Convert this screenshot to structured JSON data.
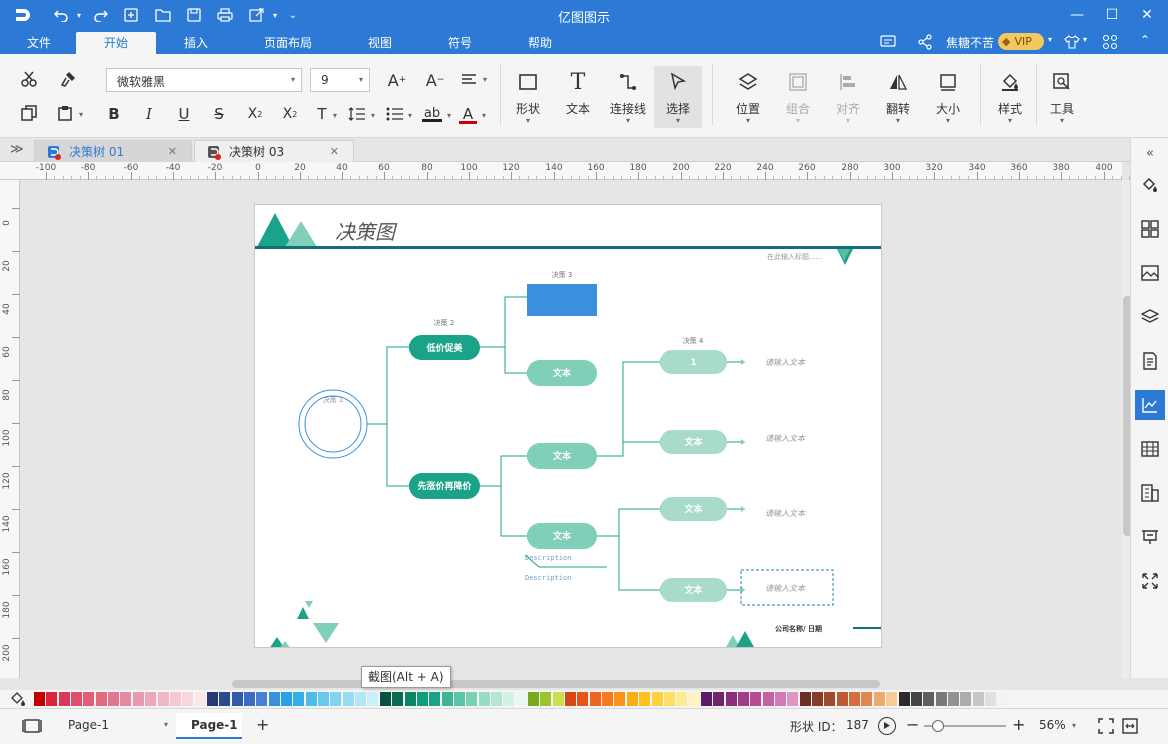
{
  "app": {
    "title": "亿图图示"
  },
  "menubar": {
    "tabs": [
      "文件",
      "开始",
      "插入",
      "页面布局",
      "视图",
      "符号",
      "帮助"
    ],
    "active": "开始",
    "user_name": "焦糖不苦",
    "vip_label": "VIP"
  },
  "ribbon": {
    "font_name": "微软雅黑",
    "font_size": "9",
    "groups": {
      "shape": "形状",
      "text": "文本",
      "connector": "连接线",
      "select": "选择",
      "position": "位置",
      "group": "组合",
      "align": "对齐",
      "flip": "翻转",
      "size": "大小",
      "style": "样式",
      "tools": "工具"
    }
  },
  "doc_tabs": [
    {
      "label": "决策树 01",
      "active": true
    },
    {
      "label": "决策树 03",
      "active": false
    }
  ],
  "ruler": {
    "h_ticks": [
      "-100",
      "-80",
      "-60",
      "-40",
      "-20",
      "0",
      "20",
      "40",
      "60",
      "80",
      "100",
      "120",
      "140",
      "160",
      "180",
      "200",
      "220",
      "240",
      "260",
      "280",
      "300",
      "320",
      "340",
      "360",
      "380",
      "400"
    ],
    "v_ticks": [
      "0",
      "20",
      "40",
      "60",
      "80",
      "100",
      "120",
      "140",
      "160",
      "180",
      "200"
    ]
  },
  "diagram": {
    "title": "决策图",
    "subtitle_hint": "在此输入标题......",
    "root_label": "决策 1",
    "label_decision2": "决策 2",
    "label_decision3": "决策 3",
    "label_decision4": "决策 4",
    "node_low_price": "低价促美",
    "node_first_price": "先涨价再降价",
    "node_text": "文本",
    "node_one": "1",
    "desc1": "Description",
    "desc2": "Description",
    "hint_text": "请输入文本",
    "footer": "公司名称/ 日期"
  },
  "tooltip": "截图(Alt + A)",
  "status": {
    "page_selector": "Page-1",
    "page_tab": "Page-1",
    "add_page": "+",
    "shape_id_label": "形状 ID：",
    "shape_id": "187",
    "zoom_minus": "−",
    "zoom_plus": "+",
    "zoom": "56%",
    "zoom_fraction": 0.12
  },
  "colors": {
    "accent": "#2d7ad6",
    "teal": "#1aa389",
    "teal_light": "#80cfb9",
    "mint": "#a8dcc9",
    "blue_box": "#3a8fde",
    "divider": "#146e7a",
    "palette": [
      "#c00000",
      "#d9243b",
      "#e0355b",
      "#e04e6e",
      "#e65c76",
      "#e06c7e",
      "#e07791",
      "#e58aa0",
      "#ea9aaf",
      "#f0a8b8",
      "#f3b7c4",
      "#f6c7d1",
      "#f8d6de",
      "#fbe6ea",
      "#293a73",
      "#2c4a8e",
      "#2f5ba8",
      "#3a6cc4",
      "#4a7fd6",
      "#3a8fde",
      "#2aa0e6",
      "#33b0ea",
      "#4dbeec",
      "#66caef",
      "#80d4f1",
      "#99ddf4",
      "#b3e6f7",
      "#cdeffa",
      "#08503f",
      "#0a6a52",
      "#0c8466",
      "#109e7a",
      "#1aa389",
      "#3bb597",
      "#5cc3a6",
      "#7ad0b5",
      "#98dcc4",
      "#b5e7d3",
      "#d2f2e2",
      "#e8f8f0",
      "#7aa820",
      "#99c42c",
      "#c9e04a",
      "#d84616",
      "#e8531c",
      "#f06424",
      "#f57b1e",
      "#fa9319",
      "#fcac16",
      "#fdc120",
      "#fdd140",
      "#fde068",
      "#feeb92",
      "#fff4bb",
      "#5e1b6a",
      "#73246f",
      "#8a2f7c",
      "#a13c88",
      "#b74b96",
      "#c561a6",
      "#d27ab6",
      "#df95c6",
      "#6b2f23",
      "#863c2a",
      "#a24a30",
      "#bf5937",
      "#d76d3d",
      "#e3874e",
      "#edaa6f",
      "#f5cc96",
      "#2b2b2b",
      "#444444",
      "#5e5e5e",
      "#787878",
      "#929292",
      "#acacac",
      "#c6c6c6",
      "#e0e0e0",
      "#f2f2f2"
    ]
  }
}
